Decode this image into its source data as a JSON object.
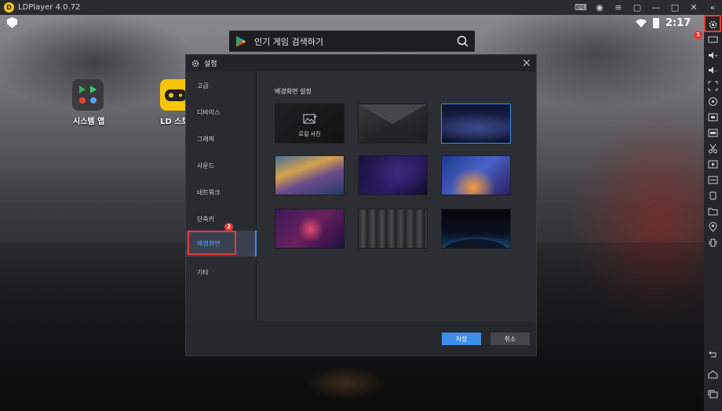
{
  "window": {
    "title": "LDPlayer 4.0.72",
    "logo_letter": "D",
    "titlebar_icons": [
      "gamepad-icon",
      "account-icon",
      "menu-icon",
      "restore-icon",
      "minimize-icon",
      "maximize-icon",
      "close-icon",
      "collapse-icon"
    ]
  },
  "statusbar": {
    "time": "2:17"
  },
  "search": {
    "placeholder": "인기 게임 검색하기"
  },
  "desktop": {
    "apps": [
      {
        "label": "시스템 앱"
      },
      {
        "label": "LD 스토"
      }
    ]
  },
  "toolbar": {
    "badge_settings": "1",
    "tools": [
      "settings-icon",
      "keyboard-icon",
      "volume-up-icon",
      "volume-down-icon",
      "fullscreen-icon",
      "rotate-icon",
      "apk-install-icon",
      "screenshot-icon",
      "scissors-icon",
      "record-icon",
      "macro-icon",
      "sync-icon",
      "folder-icon",
      "location-icon",
      "shake-icon",
      "back-icon",
      "home-icon",
      "recent-apps-icon"
    ]
  },
  "dialog": {
    "title": "설정",
    "nav": [
      {
        "label": "고급"
      },
      {
        "label": "디바이스"
      },
      {
        "label": "그래픽"
      },
      {
        "label": "사운드"
      },
      {
        "label": "네트워크"
      },
      {
        "label": "단축키"
      },
      {
        "label": "배경화면"
      },
      {
        "label": "기타"
      }
    ],
    "active_nav": "배경화면",
    "badge_nav": "2",
    "section_title": "배경화면 설정",
    "local_photo_label": "로컬 사진",
    "selected_index": 2,
    "save_label": "저장",
    "cancel_label": "취소"
  },
  "colors": {
    "accent": "#3d8fe8",
    "highlight": "#e53935",
    "store_yellow": "#f7c600"
  }
}
